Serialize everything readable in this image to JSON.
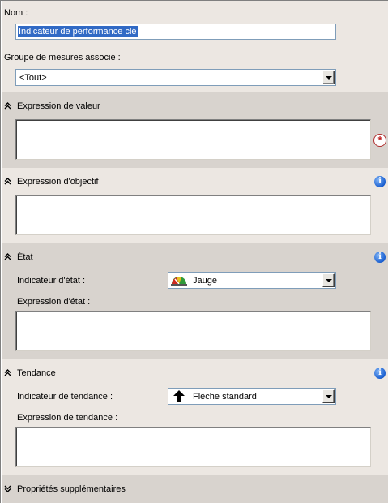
{
  "name": {
    "label": "Nom :",
    "value": "Indicateur de performance clé"
  },
  "measure_group": {
    "label": "Groupe de mesures associé :",
    "value": "<Tout>"
  },
  "value_section": {
    "title": "Expression de valeur",
    "expression": ""
  },
  "goal_section": {
    "title": "Expression d'objectif",
    "expression": ""
  },
  "status_section": {
    "title": "État",
    "indicator_label": "Indicateur d'état :",
    "indicator_value": "Jauge",
    "indicator_icon": "gauge-icon",
    "expression_label": "Expression d'état :",
    "expression": ""
  },
  "trend_section": {
    "title": "Tendance",
    "indicator_label": "Indicateur de tendance :",
    "indicator_value": "Flèche standard",
    "indicator_icon": "up-arrow-icon",
    "expression_label": "Expression de tendance :",
    "expression": ""
  },
  "additional_section": {
    "title": "Propriétés supplémentaires"
  },
  "colors": {
    "light_band": "#ece7e2",
    "dark_band": "#d8d3ce",
    "info_blue": "#1a5fd0",
    "required_red": "#c02020",
    "selection": "#316ac5"
  }
}
